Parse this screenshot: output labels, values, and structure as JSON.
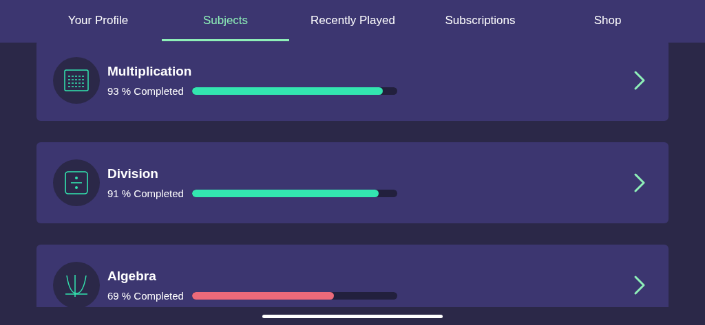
{
  "tabs": [
    {
      "label": "Your Profile",
      "selected": false
    },
    {
      "label": "Subjects",
      "selected": true
    },
    {
      "label": "Recently Played",
      "selected": false
    },
    {
      "label": "Subscriptions",
      "selected": false
    },
    {
      "label": "Shop",
      "selected": false
    }
  ],
  "subjects": [
    {
      "kind": "grid",
      "title": "Multiplication",
      "progress": "93 % Completed",
      "level": 0.93,
      "color": "#33e6b0"
    },
    {
      "kind": "divide",
      "title": "Division",
      "progress": "91 % Completed",
      "level": 0.91,
      "color": "#33e6b0"
    },
    {
      "kind": "graph",
      "title": "Algebra",
      "progress": "69 % Completed",
      "level": 0.69,
      "color": "#ec6a7a"
    }
  ]
}
